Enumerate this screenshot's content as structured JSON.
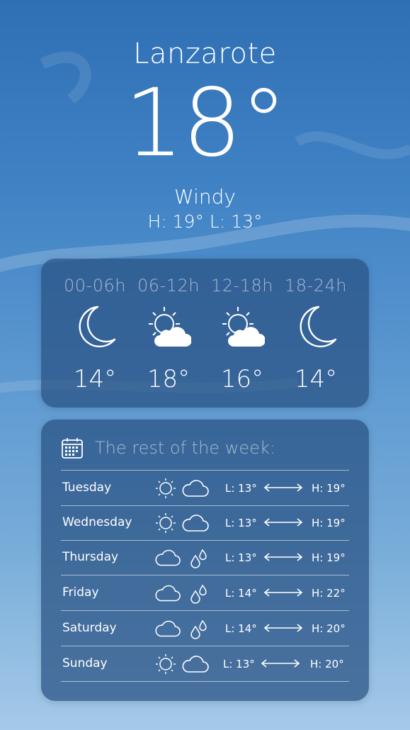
{
  "location": {
    "city": "Lanzarote"
  },
  "current": {
    "temperature": "18°",
    "condition": "Windy",
    "high_low": "H: 19° L: 13°"
  },
  "hourly": [
    {
      "label": "00-06h",
      "icon": "moon-icon",
      "temp": "14°"
    },
    {
      "label": "06-12h",
      "icon": "sun-cloud-icon",
      "temp": "18°"
    },
    {
      "label": "12-18h",
      "icon": "sun-cloud-icon",
      "temp": "16°"
    },
    {
      "label": "18-24h",
      "icon": "moon-icon",
      "temp": "14°"
    }
  ],
  "week": {
    "title": "The rest of the week:",
    "title_icon": "calendar-icon",
    "days": [
      {
        "day": "Tuesday",
        "icons": [
          "sun-icon",
          "cloud-icon"
        ],
        "low": "L: 13°",
        "high": "H: 19°"
      },
      {
        "day": "Wednesday",
        "icons": [
          "sun-icon",
          "cloud-icon"
        ],
        "low": "L: 13°",
        "high": "H: 19°"
      },
      {
        "day": "Thursday",
        "icons": [
          "cloud-icon",
          "rain-drops-icon"
        ],
        "low": "L: 13°",
        "high": "H: 19°"
      },
      {
        "day": "Friday",
        "icons": [
          "cloud-icon",
          "rain-drops-icon"
        ],
        "low": "L: 14°",
        "high": "H: 22°"
      },
      {
        "day": "Saturday",
        "icons": [
          "cloud-icon",
          "rain-drops-icon"
        ],
        "low": "L: 14°",
        "high": "H: 20°"
      },
      {
        "day": "Sunday",
        "icons": [
          "sun-icon",
          "cloud-icon"
        ],
        "low": "L: 13°",
        "high": "H: 20°"
      }
    ]
  }
}
